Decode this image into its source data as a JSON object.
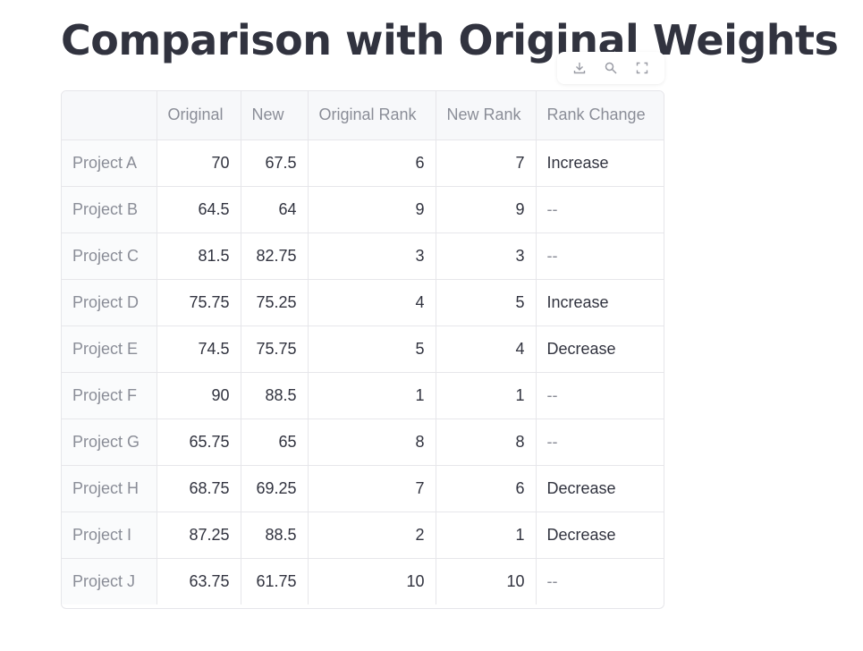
{
  "page": {
    "title": "Comparison with Original Weights"
  },
  "toolbar": {
    "icons": [
      "download-icon",
      "search-icon",
      "fullscreen-icon"
    ]
  },
  "table": {
    "columns": [
      "",
      "Original",
      "New",
      "Original Rank",
      "New Rank",
      "Rank Change"
    ],
    "rows": [
      {
        "index": "Project A",
        "original": "70",
        "new": "67.5",
        "original_rank": "6",
        "new_rank": "7",
        "rank_change": "Increase"
      },
      {
        "index": "Project B",
        "original": "64.5",
        "new": "64",
        "original_rank": "9",
        "new_rank": "9",
        "rank_change": "--"
      },
      {
        "index": "Project C",
        "original": "81.5",
        "new": "82.75",
        "original_rank": "3",
        "new_rank": "3",
        "rank_change": "--"
      },
      {
        "index": "Project D",
        "original": "75.75",
        "new": "75.25",
        "original_rank": "4",
        "new_rank": "5",
        "rank_change": "Increase"
      },
      {
        "index": "Project E",
        "original": "74.5",
        "new": "75.75",
        "original_rank": "5",
        "new_rank": "4",
        "rank_change": "Decrease"
      },
      {
        "index": "Project F",
        "original": "90",
        "new": "88.5",
        "original_rank": "1",
        "new_rank": "1",
        "rank_change": "--"
      },
      {
        "index": "Project G",
        "original": "65.75",
        "new": "65",
        "original_rank": "8",
        "new_rank": "8",
        "rank_change": "--"
      },
      {
        "index": "Project H",
        "original": "68.75",
        "new": "69.25",
        "original_rank": "7",
        "new_rank": "6",
        "rank_change": "Decrease"
      },
      {
        "index": "Project I",
        "original": "87.25",
        "new": "88.5",
        "original_rank": "2",
        "new_rank": "1",
        "rank_change": "Decrease"
      },
      {
        "index": "Project J",
        "original": "63.75",
        "new": "61.75",
        "original_rank": "10",
        "new_rank": "10",
        "rank_change": "--"
      }
    ]
  }
}
